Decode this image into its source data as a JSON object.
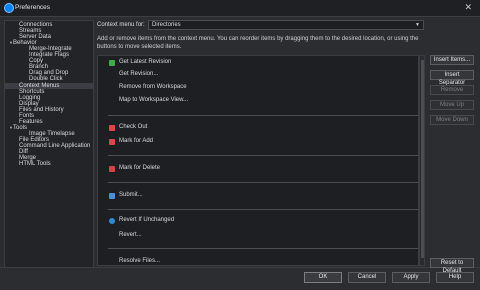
{
  "window": {
    "title": "Preferences",
    "close_glyph": "✕"
  },
  "sidebar": {
    "items": [
      {
        "label": "Connections",
        "indent": 1,
        "arrow": ""
      },
      {
        "label": "Streams",
        "indent": 1,
        "arrow": ""
      },
      {
        "label": "Server Data",
        "indent": 1,
        "arrow": ""
      },
      {
        "label": "Behavior",
        "indent": 0,
        "arrow": "▼"
      },
      {
        "label": "Merge-Integrate",
        "indent": 2,
        "arrow": ""
      },
      {
        "label": "Integrate Flags",
        "indent": 2,
        "arrow": ""
      },
      {
        "label": "Copy",
        "indent": 2,
        "arrow": ""
      },
      {
        "label": "Branch",
        "indent": 2,
        "arrow": ""
      },
      {
        "label": "Drag and Drop",
        "indent": 2,
        "arrow": ""
      },
      {
        "label": "Double Click",
        "indent": 2,
        "arrow": ""
      },
      {
        "label": "Context Menus",
        "indent": 1,
        "arrow": "",
        "selected": true
      },
      {
        "label": "Shortcuts",
        "indent": 1,
        "arrow": ""
      },
      {
        "label": "Logging",
        "indent": 1,
        "arrow": ""
      },
      {
        "label": "Display",
        "indent": 1,
        "arrow": ""
      },
      {
        "label": "Files and History",
        "indent": 1,
        "arrow": ""
      },
      {
        "label": "Fonts",
        "indent": 1,
        "arrow": ""
      },
      {
        "label": "Features",
        "indent": 1,
        "arrow": ""
      },
      {
        "label": "Tools",
        "indent": 0,
        "arrow": "▼"
      },
      {
        "label": "Image Timelapse",
        "indent": 2,
        "arrow": ""
      },
      {
        "label": "File Editors",
        "indent": 1,
        "arrow": ""
      },
      {
        "label": "Command Line Application",
        "indent": 1,
        "arrow": ""
      },
      {
        "label": "Diff",
        "indent": 1,
        "arrow": ""
      },
      {
        "label": "Merge",
        "indent": 1,
        "arrow": ""
      },
      {
        "label": "HTML Tools",
        "indent": 1,
        "arrow": ""
      }
    ]
  },
  "context_menu": {
    "label": "Context menu for:",
    "selected": "Directories",
    "caret": "▼"
  },
  "description": "Add or remove items from the context menu. You can reorder items by dragging them to the desired location, or using the buttons to move selected items.",
  "menu_items": [
    {
      "label": "Get Latest Revision",
      "icon": "get-latest-icon",
      "icon_color": "#3fae49"
    },
    {
      "label": "Get Revision...",
      "icon": ""
    },
    {
      "label": "Remove from Workspace",
      "icon": ""
    },
    {
      "label": "Map to Workspace View...",
      "icon": ""
    },
    {
      "label": "Check Out",
      "icon": "checkout-icon",
      "icon_color": "#e04444"
    },
    {
      "label": "Mark for Add",
      "icon": "add-icon",
      "icon_color": "#d44a4a"
    },
    {
      "label": "Mark for Delete",
      "icon": "delete-icon",
      "icon_color": "#d04545"
    },
    {
      "label": "Submit...",
      "icon": "submit-icon",
      "icon_color": "#4a90d9"
    },
    {
      "label": "Revert If Unchanged",
      "icon": "revert-icon",
      "icon_color": "#2e8ad8"
    },
    {
      "label": "Revert...",
      "icon": ""
    },
    {
      "label": "Resolve Files...",
      "icon": ""
    }
  ],
  "side_buttons": [
    {
      "label": "Insert Items...",
      "disabled": false
    },
    {
      "label": "Insert Separator",
      "disabled": false
    },
    {
      "label": "Remove",
      "disabled": true
    },
    {
      "label": "Move Up",
      "disabled": true
    },
    {
      "label": "Move Down",
      "disabled": true
    }
  ],
  "footer": {
    "ok": "OK",
    "cancel": "Cancel",
    "apply": "Apply",
    "help": "Help",
    "reset": "Reset to Default"
  }
}
